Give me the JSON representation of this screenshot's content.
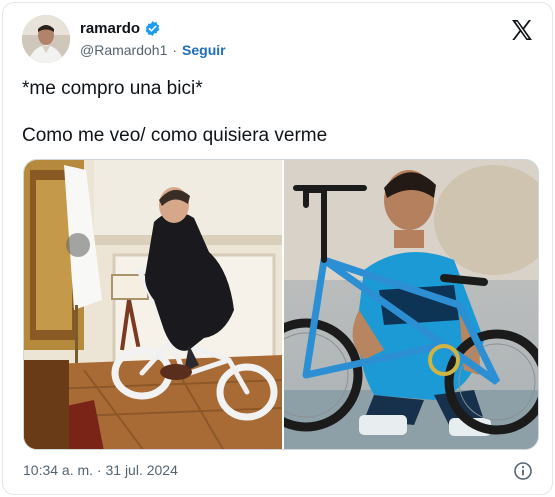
{
  "tweet": {
    "author_name": "ramardo",
    "author_handle": "@Ramardoh1",
    "separator": "·",
    "follow_label": "Seguir",
    "verified": true,
    "text_line1": "*me compro una bici*",
    "text_line2": "Como me veo/ como quisiera verme",
    "timestamp": "10:34 a. m. · 31 jul. 2024"
  },
  "icons": {
    "verified": "verified-badge-icon",
    "logo": "x-logo-icon",
    "info": "info-icon"
  },
  "colors": {
    "verified_badge": "#1d9bf0",
    "follow_link": "#1d6fb8",
    "secondary_text": "#536471",
    "border": "#e3e7ea"
  }
}
